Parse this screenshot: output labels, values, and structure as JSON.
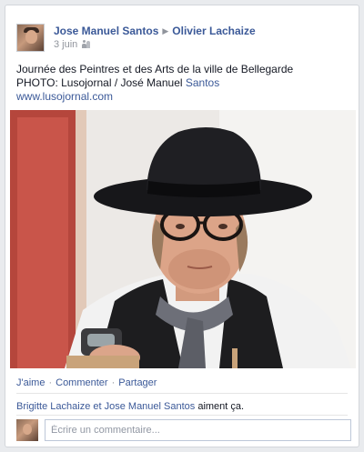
{
  "post": {
    "author": "Jose Manuel Santos",
    "arrow": "▶",
    "recipient": "Olivier Lachaize",
    "date": "3 juin",
    "audience_icon": "friends-icon",
    "text_line1": "Journée des Peintres et des Arts de la ville de Bellegarde",
    "text_line2_prefix": "PHOTO: Lusojornal / José Manuel ",
    "text_line2_link": "Santos",
    "link_url_text": "www.lusojornal.com",
    "photo_description_icon": "photo"
  },
  "actions": {
    "like": "J'aime",
    "comment": "Commenter",
    "share": "Partager",
    "separator": "·"
  },
  "likes": {
    "names": "Brigitte Lachaize et Jose Manuel Santos",
    "suffix": " aiment ça."
  },
  "comment": {
    "placeholder": "Écrire un commentaire..."
  },
  "colors": {
    "link": "#3b5998",
    "text": "#141823",
    "muted": "#90949c",
    "background": "#e9ebee"
  }
}
